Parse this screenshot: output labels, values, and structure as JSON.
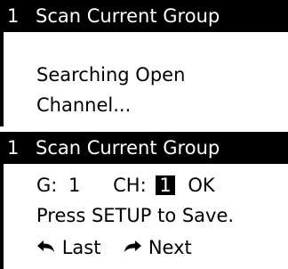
{
  "screen1": {
    "menu_number": "1",
    "title": "Scan Current Group",
    "message_line1": "Searching Open",
    "message_line2": "Channel..."
  },
  "screen2": {
    "menu_number": "1",
    "title": "Scan Current Group",
    "group_label": "G:",
    "group_value": "1",
    "channel_label": "CH:",
    "channel_value": "1",
    "status": "OK",
    "instruction": "Press SETUP to Save.",
    "nav": {
      "last_label": "Last",
      "next_label": "Next"
    },
    "icons": {
      "last": "undo-arrow-icon",
      "next": "redo-arrow-icon"
    }
  },
  "colors": {
    "title_bg": "#000000",
    "title_fg": "#ffffff",
    "body_bg": "#ffffff",
    "text": "#000000"
  }
}
